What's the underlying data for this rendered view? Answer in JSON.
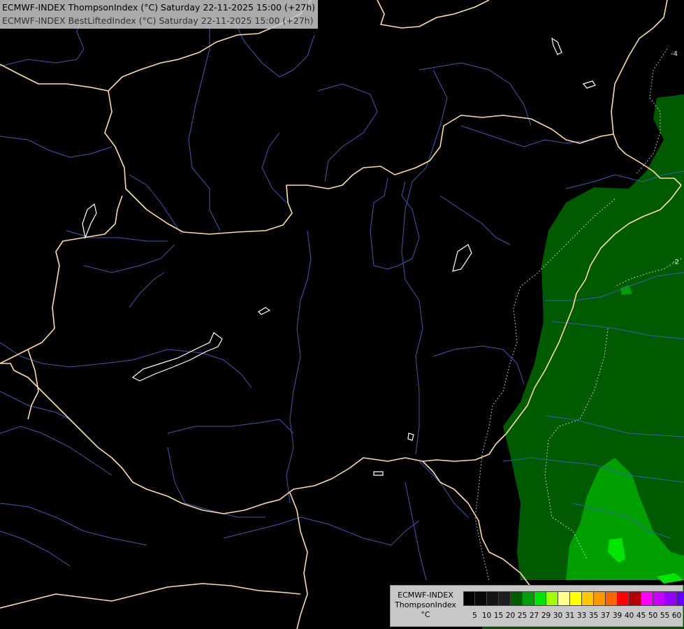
{
  "header": {
    "line1": "ECMWF-INDEX ThompsonIndex (°C) Saturday 22-11-2025 15:00 (+27h)",
    "line2": "ECMWF-INDEX BestLiftedIndex (°C) Saturday 22-11-2025 15:00 (+27h)"
  },
  "legend": {
    "model": "ECMWF-INDEX",
    "parameter": "ThompsonIndex",
    "unit": "°C",
    "colors": [
      "#000000",
      "#0a0a0a",
      "#141414",
      "#1e1e1e",
      "#005a00",
      "#00a000",
      "#00e600",
      "#a0ff00",
      "#ffff8c",
      "#ffff00",
      "#ffc800",
      "#ff9600",
      "#ff6400",
      "#ff0000",
      "#b40000",
      "#ff00ff",
      "#c800ff",
      "#9600ff",
      "#6400ff",
      "#0000ff"
    ],
    "ticks": [
      "5",
      "10",
      "15",
      "20",
      "25",
      "27",
      "29",
      "30",
      "31",
      "33",
      "35",
      "37",
      "39",
      "40",
      "45",
      "50",
      "55",
      "60"
    ]
  },
  "map": {
    "contour_labels": [
      "-4",
      "-2"
    ]
  }
}
